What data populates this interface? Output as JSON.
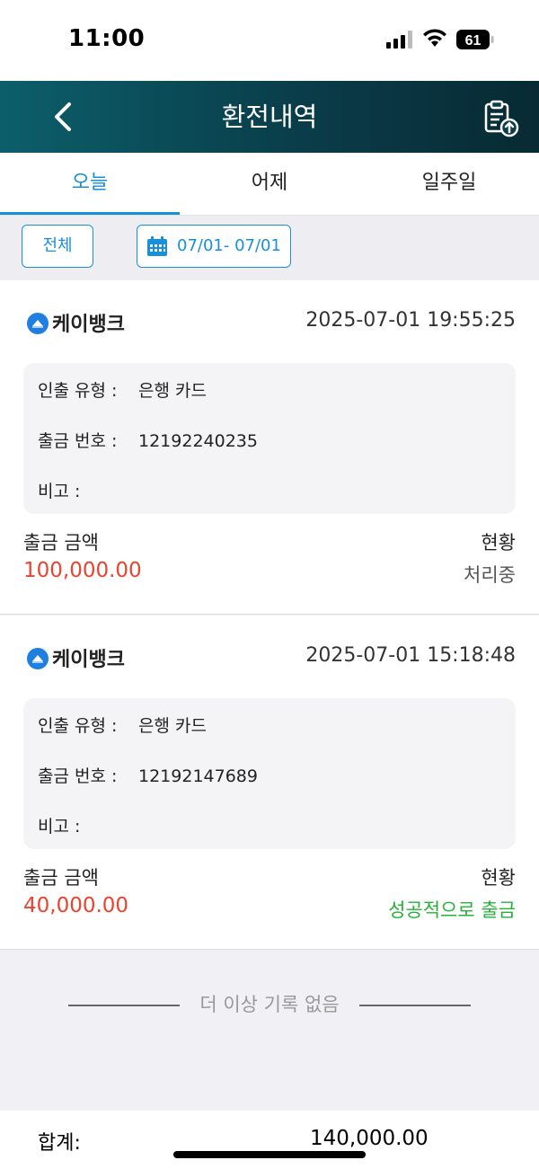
{
  "status_bar": {
    "time": "11:00",
    "battery_level": "61"
  },
  "header": {
    "title": "환전내역",
    "back_icon": "chevron-left-icon",
    "export_icon": "clipboard-upload-icon"
  },
  "tabs": [
    {
      "label": "오늘",
      "active": true
    },
    {
      "label": "어제",
      "active": false
    },
    {
      "label": "일주일",
      "active": false
    }
  ],
  "filters": {
    "all_label": "전체",
    "date_range": "07/01- 07/01"
  },
  "records": [
    {
      "bank": "케이뱅크",
      "datetime": "2025-07-01 19:55:25",
      "withdraw_type_label": "인출 유형 :",
      "withdraw_type": "은행 카드",
      "order_no_label": "출금 번호 :",
      "order_no": "12192240235",
      "note_label": "비고 :",
      "note": "",
      "amount_label": "출금 금액",
      "amount": "100,000.00",
      "status_label": "현황",
      "status": "처리중"
    },
    {
      "bank": "케이뱅크",
      "datetime": "2025-07-01 15:18:48",
      "withdraw_type_label": "인출 유형 :",
      "withdraw_type": "은행 카드",
      "order_no_label": "출금 번호 :",
      "order_no": "12192147689",
      "note_label": "비고 :",
      "note": "",
      "amount_label": "출금 금액",
      "amount": "40,000.00",
      "status_label": "현황",
      "status": "성공적으로 출금"
    }
  ],
  "end_note": "더 이상 기록 없음",
  "total": {
    "label": "합계:",
    "value": "140,000.00"
  },
  "colors": {
    "accent": "#1a8fd9",
    "amount": "#e8442f",
    "success": "#27b13a",
    "header_start": "#0b5f6a",
    "header_end": "#082a33"
  }
}
